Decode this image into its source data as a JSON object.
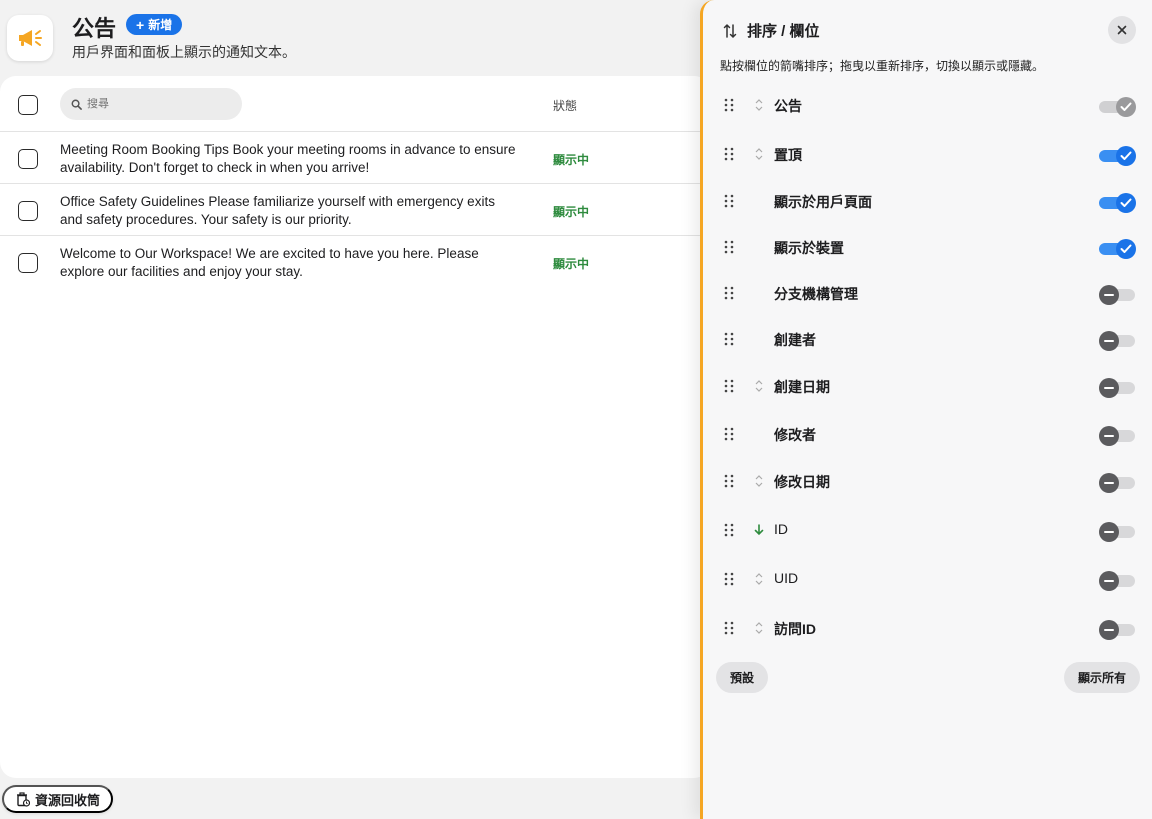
{
  "header": {
    "title": "公告",
    "add_label": "新增",
    "subtitle": "用戶界面和面板上顯示的通知文本。",
    "icon": "megaphone-icon",
    "accent": "#f5a623"
  },
  "table": {
    "search_placeholder": "搜尋",
    "status_header": "狀態",
    "rows": [
      {
        "text": "Meeting Room Booking Tips Book your meeting rooms in advance to ensure availability. Don't forget to check in when you arrive!",
        "status": "顯示中"
      },
      {
        "text": "Office Safety Guidelines Please familiarize yourself with emergency exits and safety procedures. Your safety is our priority.",
        "status": "顯示中"
      },
      {
        "text": "Welcome to Our Workspace! We are excited to have you here. Please explore our facilities and enjoy your stay.",
        "status": "顯示中"
      }
    ],
    "status_color": "#2e8b3e"
  },
  "footer": {
    "trash_label": "資源回收筒"
  },
  "panel": {
    "title": "排序 / 欄位",
    "description": "點按欄位的箭嘴排序；拖曳以重新排序，切換以顯示或隱藏。",
    "fields": [
      {
        "label": "公告",
        "sort": "sortable",
        "state": "locked"
      },
      {
        "label": "置頂",
        "sort": "sortable",
        "state": "on"
      },
      {
        "label": "顯示於用戶頁面",
        "sort": "none",
        "state": "on"
      },
      {
        "label": "顯示於裝置",
        "sort": "none",
        "state": "on"
      },
      {
        "label": "分支機構管理",
        "sort": "none",
        "state": "off"
      },
      {
        "label": "創建者",
        "sort": "none",
        "state": "off"
      },
      {
        "label": "創建日期",
        "sort": "sortable",
        "state": "off"
      },
      {
        "label": "修改者",
        "sort": "none",
        "state": "off"
      },
      {
        "label": "修改日期",
        "sort": "sortable",
        "state": "off"
      },
      {
        "label": "ID",
        "sort": "descending",
        "state": "off"
      },
      {
        "label": "UID",
        "sort": "sortable",
        "state": "off"
      },
      {
        "label": "訪問ID",
        "sort": "sortable",
        "state": "off"
      }
    ],
    "default_label": "預設",
    "show_all_label": "顯示所有",
    "toggle_on_color": "#1a73e8",
    "sort_active_color": "#2e8b3e"
  }
}
